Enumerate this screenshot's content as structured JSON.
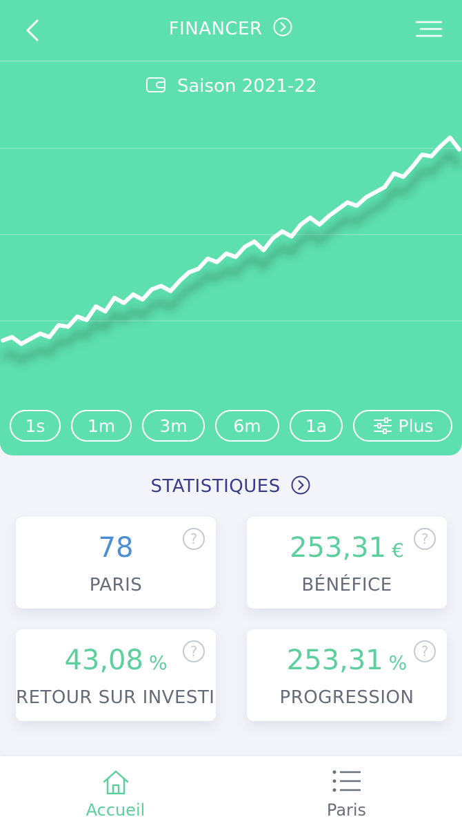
{
  "header": {
    "title": "FINANCER"
  },
  "season": {
    "label": "Saison 2021-22"
  },
  "chart_data": {
    "type": "line",
    "title": "",
    "x": [
      0,
      1,
      2,
      3,
      4,
      5,
      6,
      7,
      8,
      9,
      10,
      11,
      12,
      13,
      14,
      15,
      16,
      17,
      18,
      19,
      20,
      21,
      22,
      23,
      24,
      25,
      26,
      27,
      28,
      29,
      30,
      31,
      32,
      33,
      34,
      35,
      36,
      37,
      38,
      39,
      40,
      41,
      42,
      43,
      44,
      45,
      46,
      47,
      48,
      49
    ],
    "values": [
      31,
      33,
      29,
      32,
      35,
      33,
      40,
      39,
      45,
      43,
      51,
      48,
      56,
      53,
      58,
      55,
      61,
      63,
      60,
      66,
      71,
      73,
      79,
      77,
      82,
      80,
      86,
      89,
      84,
      91,
      95,
      92,
      99,
      103,
      99,
      104,
      108,
      112,
      110,
      115,
      118,
      121,
      129,
      127,
      133,
      140,
      139,
      145,
      150,
      143
    ],
    "series": [
      {
        "name": "",
        "color": "#ffffff"
      }
    ],
    "ylim": [
      0,
      170
    ],
    "grid": true
  },
  "periods": [
    "1s",
    "1m",
    "3m",
    "6m",
    "1a",
    "Plus"
  ],
  "statistics": {
    "title": "STATISTIQUES",
    "cards": [
      {
        "value": "78",
        "unit": "",
        "label": "PARIS",
        "color": "#4a8fd4"
      },
      {
        "value": "253,31",
        "unit": "€",
        "label": "BÉNÉFICE",
        "color": "#5ccf9d"
      },
      {
        "value": "43,08",
        "unit": "%",
        "label": "RETOUR SUR INVESTISSEMENT",
        "color": "#5ccf9d"
      },
      {
        "value": "253,31",
        "unit": "%",
        "label": "PROGRESSION",
        "color": "#5ccf9d"
      }
    ],
    "help_glyph": "?"
  },
  "nav": {
    "items": [
      {
        "label": "Accueil",
        "icon": "home-icon",
        "active": true
      },
      {
        "label": "Paris",
        "icon": "list-icon",
        "active": false
      }
    ]
  },
  "colors": {
    "accent": "#5ddfaf",
    "active_nav": "#5ccf9d",
    "inactive_nav": "#6b6f7a",
    "stats_title": "#3b3a8a"
  }
}
